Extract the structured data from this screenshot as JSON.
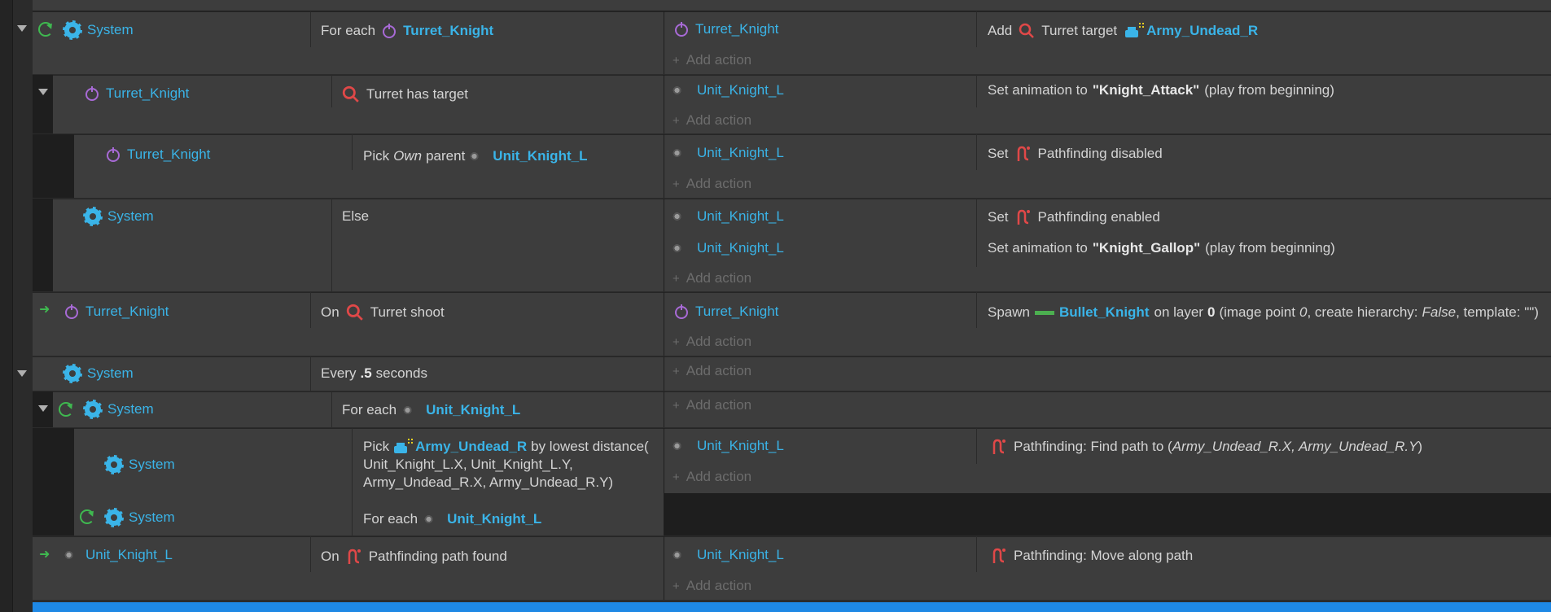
{
  "objects": {
    "system": "System",
    "turret_knight": "Turret_Knight",
    "unit_knight_l": "Unit_Knight_L",
    "army_undead_r": "Army_Undead_R",
    "bullet_knight": "Bullet_Knight"
  },
  "add_action_label": "Add action",
  "events": {
    "e1": {
      "cond_prefix": "For each",
      "act1_prefix": "Add",
      "act1_mid": "Turret target"
    },
    "e2": {
      "cond_text": "Turret has target",
      "act1_prefix": "Set animation to",
      "act1_value": "\"Knight_Attack\"",
      "act1_suffix": "(play from beginning)"
    },
    "e3": {
      "cond_pick": "Pick",
      "cond_own": "Own",
      "cond_parent": "parent",
      "act1_prefix": "Set",
      "act1_text": "Pathfinding disabled"
    },
    "e4": {
      "cond_text": "Else",
      "act1_prefix": "Set",
      "act1_text": "Pathfinding enabled",
      "act2_prefix": "Set animation to",
      "act2_value": "\"Knight_Gallop\"",
      "act2_suffix": "(play from beginning)"
    },
    "e5": {
      "cond_on": "On",
      "cond_text": "Turret shoot",
      "act1_spawn": "Spawn",
      "act1_onlayer": "on layer",
      "act1_layer": "0",
      "act1_open": "(image point",
      "act1_point": "0",
      "act1_hier": ", create hierarchy:",
      "act1_false": "False",
      "act1_tmpl": ", template: \"\")"
    },
    "e6": {
      "cond_every": "Every",
      "cond_value": ".5",
      "cond_unit": "seconds"
    },
    "e7": {
      "cond_prefix": "For each"
    },
    "e8": {
      "cond_pick": "Pick",
      "cond_by": "by lowest distance(",
      "cond_line2": "Unit_Knight_L.X, Unit_Knight_L.Y,",
      "cond_line3": "Army_Undead_R.X, Army_Undead_R.Y)",
      "cond2_prefix": "For each",
      "act1_prefix": "Pathfinding: Find path to (",
      "act1_args": "Army_Undead_R.X, Army_Undead_R.Y",
      "act1_close": ")"
    },
    "e9": {
      "cond_on": "On",
      "cond_text": "Pathfinding path found",
      "act1_text": "Pathfinding: Move along path"
    }
  },
  "colors": {
    "object_link": "#3ab4e8",
    "turret_icon": "#a86ad6",
    "behavior_icon": "#e04848",
    "loop_arrow": "#3fb950",
    "selection_bar": "#1e88e5"
  }
}
